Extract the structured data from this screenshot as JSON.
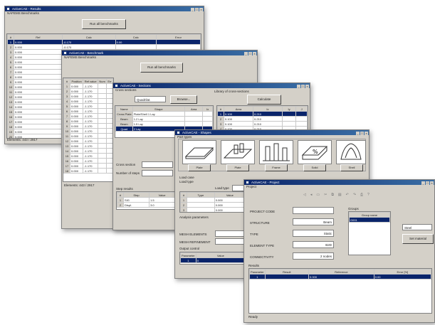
{
  "window1": {
    "title": "ActiveCAE - Results",
    "menu": "NAFEMS Benchmarks",
    "button": "Run all benchmarks",
    "columns": [
      "#",
      "Ref",
      "Calc",
      "Calc",
      "Error"
    ],
    "rows": [
      [
        "1",
        "0.000",
        "-0.170",
        "0.00",
        ""
      ],
      [
        "2",
        "0.000",
        "-0.170",
        "",
        ""
      ],
      [
        "3",
        "0.000",
        "-0.170",
        "",
        ""
      ],
      [
        "4",
        "0.000",
        "-0.170",
        "",
        ""
      ],
      [
        "5",
        "0.000",
        "-0.170",
        "",
        ""
      ],
      [
        "6",
        "0.000",
        "-0.170",
        "",
        ""
      ],
      [
        "7",
        "0.000",
        "-0.170",
        "",
        ""
      ],
      [
        "8",
        "0.000",
        "-0.170",
        "",
        ""
      ],
      [
        "9",
        "0.000",
        "-0.170",
        "",
        ""
      ],
      [
        "10",
        "0.000",
        "-0.170",
        "",
        ""
      ],
      [
        "11",
        "0.000",
        "-0.170",
        "",
        ""
      ],
      [
        "12",
        "0.000",
        "-0.170",
        "",
        ""
      ],
      [
        "13",
        "0.000",
        "-0.170",
        "",
        ""
      ],
      [
        "14",
        "0.000",
        "-0.170",
        "",
        ""
      ],
      [
        "15",
        "0.000",
        "-0.170",
        "",
        ""
      ],
      [
        "16",
        "0.000",
        "-0.170",
        "",
        ""
      ],
      [
        "17",
        "0.000",
        "-0.170",
        "",
        ""
      ],
      [
        "18",
        "0.000",
        "-0.170",
        "",
        ""
      ],
      [
        "19",
        "0.000",
        "-0.170",
        "",
        ""
      ],
      [
        "20",
        "0.000",
        "-0.170",
        "",
        ""
      ]
    ],
    "status": "Elements: 443 / 2917"
  },
  "window2": {
    "title": "ActiveCAE - Benchmark",
    "menu": "NAFEMS Benchmarks",
    "button": "Run all benchmarks",
    "columns": [
      "#",
      "Position",
      "Ref value",
      "Num",
      "Err"
    ],
    "rows": [
      [
        "1",
        "0.000",
        "-1.170"
      ],
      [
        "2",
        "0.000",
        "-1.170"
      ],
      [
        "3",
        "0.000",
        "-1.170"
      ],
      [
        "4",
        "0.000",
        "-1.170"
      ],
      [
        "5",
        "0.000",
        "-1.170"
      ],
      [
        "6",
        "0.000",
        "-1.170"
      ],
      [
        "7",
        "0.000",
        "-1.170"
      ],
      [
        "8",
        "0.000",
        "-1.170"
      ],
      [
        "9",
        "0.000",
        "-1.170"
      ],
      [
        "10",
        "0.000",
        "-1.170"
      ],
      [
        "11",
        "0.000",
        "-1.170"
      ],
      [
        "12",
        "0.000",
        "-1.170"
      ],
      [
        "13",
        "0.000",
        "-1.170"
      ],
      [
        "14",
        "0.000",
        "-1.170"
      ],
      [
        "15",
        "0.000",
        "-1.170"
      ],
      [
        "16",
        "0.000",
        "-1.170"
      ],
      [
        "17",
        "0.000",
        "-1.170"
      ],
      [
        "18",
        "0.000",
        "-1.170"
      ]
    ],
    "label_a": "Physical data",
    "label_b": "NAFEMS benchmark data",
    "mesh_label": "Mesh element type",
    "mesh_value": "",
    "fine_label": "Fine",
    "fine_value": "10",
    "sub_label": "Run · Data view",
    "sub_columns": [
      "Load",
      "Type",
      "Value"
    ],
    "sub_rows": [
      [
        "1",
        "SIG",
        "1.2"
      ],
      [
        "2",
        "Displ.",
        "1.6"
      ]
    ],
    "status": "Elements: 443 / 2917",
    "footer": "CPU time: 5.1 s"
  },
  "window3": {
    "title": "ActiveCAE - Sections",
    "menu": "Cross sections",
    "top_label": "Library of cross-sections",
    "search_value": "Quadrilat.",
    "browse_button": "Browse...",
    "calc_button": "Calculate",
    "list_columns": [
      "Name",
      "Shape",
      "Area",
      "Ix"
    ],
    "list_rows": [
      [
        "Cross Plate",
        "Plate/Shell 1 Lay"
      ],
      [
        "Beam",
        "1.2 Lay"
      ],
      [
        "Beam",
        "1.5 Lay"
      ],
      [
        "Quad",
        "2 Lay"
      ]
    ],
    "prop_columns": [
      "#",
      "Area",
      "Ix",
      "Iy",
      "J"
    ],
    "prop_rows": [
      [
        "1",
        "0.100",
        "0.210"
      ],
      [
        "2",
        "0.100",
        "0.210"
      ],
      [
        "3",
        "0.100",
        "0.210"
      ],
      [
        "4",
        "0.100",
        "0.210"
      ],
      [
        "5",
        "0.100",
        "0.210"
      ]
    ],
    "summary_label": "Cross section",
    "summary_value": "",
    "count_label": "Number of steps",
    "count_value": "",
    "bottom_title": "Step results",
    "bottom_columns": [
      "#",
      "Step",
      "Value"
    ],
    "bottom_rows": [
      [
        "1",
        "SIG",
        "1.5"
      ],
      [
        "2",
        "Displ.",
        "3.0"
      ]
    ]
  },
  "window4": {
    "title": "ActiveCAE - Shapes",
    "menu": "Part types",
    "shapes": [
      "Plate",
      "Plate",
      "Frame",
      "Solid",
      "Shell"
    ],
    "load_label": "Load case",
    "load_sub": "Load type",
    "combo_value": "",
    "combo_label": "Load type",
    "grid_columns": [
      "#",
      "Type",
      "Value"
    ],
    "grid_rows": [
      [
        "1",
        "",
        "0.000"
      ],
      [
        "2",
        "",
        "0.000"
      ],
      [
        "3",
        "",
        "0.000"
      ]
    ],
    "param_label": "Analysis parameters",
    "field_a_label": "MESH ELEMENTS",
    "field_b_label": "MESH REFINEMENT",
    "field_c_label": "Output control",
    "result_columns": [
      "Parameter",
      "Value"
    ],
    "result_rows": [
      [
        "1",
        "0"
      ]
    ]
  },
  "window5": {
    "title": "ActiveCAE - Project",
    "menu": "Project",
    "toolbar_icons": [
      "new-icon",
      "open-icon",
      "save-icon",
      "cut-icon",
      "copy-icon",
      "paste-icon",
      "undo-icon",
      "redo-icon",
      "print-icon",
      "help-icon"
    ],
    "fields": [
      {
        "label": "PROJECT CODE",
        "value": ""
      },
      {
        "label": "STRUCTURE",
        "value": "Beam"
      },
      {
        "label": "TYPE",
        "value": "Static"
      },
      {
        "label": "ELEMENT TYPE",
        "value": "B2D"
      },
      {
        "label": "CONNECTIVITY",
        "value": "2 nodes"
      }
    ],
    "list_title": "Groups",
    "list_header": "Group name",
    "list_selected": "G001",
    "right_value": "Steel",
    "right_button": "Set material",
    "results_title": "Results",
    "results_columns": [
      "Parameter",
      "Result",
      "Reference",
      "Error [%]"
    ],
    "results_rows": [
      [
        "1",
        "",
        "0.000",
        "0.00"
      ]
    ],
    "status": "Ready"
  }
}
